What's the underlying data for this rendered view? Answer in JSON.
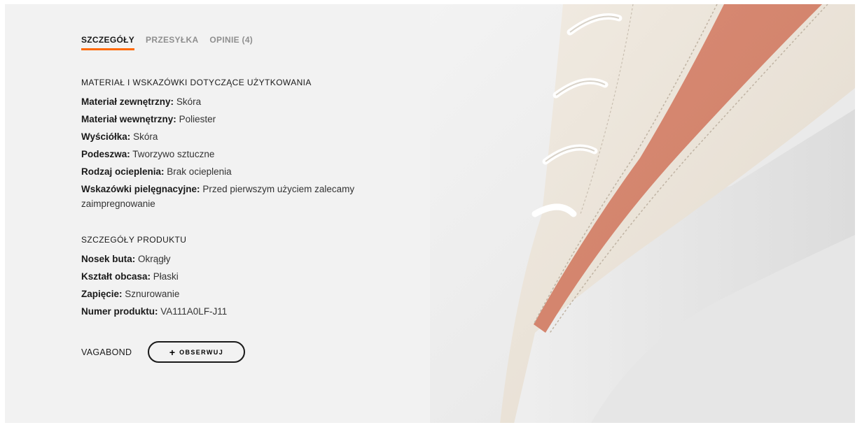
{
  "tabs": [
    {
      "label": "SZCZEGÓŁY",
      "active": true
    },
    {
      "label": "PRZESYŁKA",
      "active": false
    },
    {
      "label": "OPINIE (4)",
      "active": false
    }
  ],
  "material_section": {
    "title": "MATERIAŁ I WSKAZÓWKI DOTYCZĄCE UŻYTKOWANIA",
    "items": [
      {
        "label": "Materiał zewnętrzny:",
        "value": "Skóra"
      },
      {
        "label": "Materiał wewnętrzny:",
        "value": "Poliester"
      },
      {
        "label": "Wyściółka:",
        "value": "Skóra"
      },
      {
        "label": "Podeszwa:",
        "value": "Tworzywo sztuczne"
      },
      {
        "label": "Rodzaj ocieplenia:",
        "value": "Brak ocieplenia"
      },
      {
        "label": "Wskazówki pielęgnacyjne:",
        "value": "Przed pierwszym użyciem zalecamy zaimpregnowanie"
      }
    ]
  },
  "product_section": {
    "title": "SZCZEGÓŁY PRODUKTU",
    "items": [
      {
        "label": "Nosek buta:",
        "value": "Okrągły"
      },
      {
        "label": "Kształt obcasa:",
        "value": "Płaski"
      },
      {
        "label": "Zapięcie:",
        "value": "Sznurowanie"
      },
      {
        "label": "Numer produktu:",
        "value": "VA111A0LF-J11"
      }
    ]
  },
  "brand": {
    "name": "VAGABOND",
    "follow_icon": "plus-icon",
    "follow_label": "OBSERWUJ"
  },
  "colors": {
    "accent": "#ff6900",
    "panel_bg": "#f2f2f2",
    "shoe_leather": "#ede6dc",
    "shoe_suede": "#d98b74"
  }
}
